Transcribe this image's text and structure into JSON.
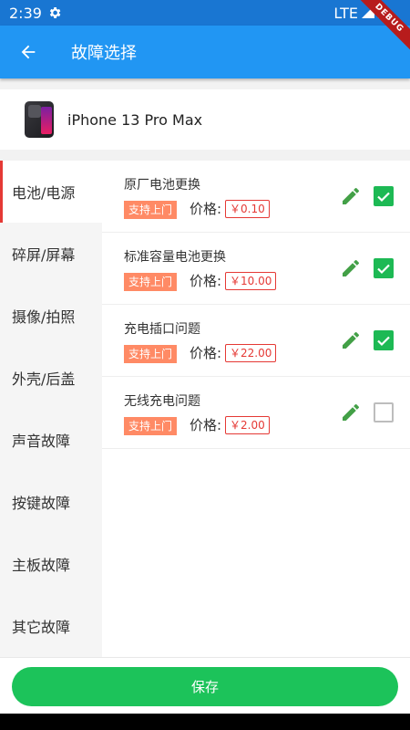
{
  "status_bar": {
    "time": "2:39",
    "network": "LTE"
  },
  "debug_banner": "DEBUG",
  "app_bar": {
    "title": "故障选择"
  },
  "device": {
    "name": "iPhone 13 Pro Max"
  },
  "categories": [
    {
      "label": "电池/电源",
      "active": true
    },
    {
      "label": "碎屏/屏幕"
    },
    {
      "label": "摄像/拍照"
    },
    {
      "label": "外壳/后盖"
    },
    {
      "label": "声音故障"
    },
    {
      "label": "按键故障"
    },
    {
      "label": "主板故障"
    },
    {
      "label": "其它故障"
    }
  ],
  "faults": [
    {
      "name": "原厂电池更换",
      "badge": "支持上门",
      "price_label": "价格:",
      "price": "￥0.10",
      "checked": true
    },
    {
      "name": "标准容量电池更换",
      "badge": "支持上门",
      "price_label": "价格:",
      "price": "￥10.00",
      "checked": true
    },
    {
      "name": "充电插口问题",
      "badge": "支持上门",
      "price_label": "价格:",
      "price": "￥22.00",
      "checked": true
    },
    {
      "name": "无线充电问题",
      "badge": "支持上门",
      "price_label": "价格:",
      "price": "￥2.00",
      "checked": false
    }
  ],
  "footer": {
    "save_label": "保存"
  },
  "colors": {
    "primary": "#2196f3",
    "status": "#1976d2",
    "accent_green": "#1cc35a",
    "price_red": "#e53935",
    "badge_orange": "#ff8a65"
  }
}
